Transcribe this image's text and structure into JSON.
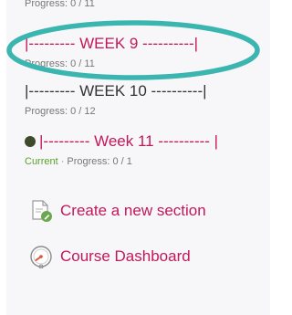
{
  "sections": [
    {
      "title": "",
      "progress": "Progress: 0 / 11"
    },
    {
      "title": "|--------- WEEK 9 ----------|",
      "progress": "Progress: 0 / 11"
    },
    {
      "title": "|--------- WEEK 10 ----------|",
      "progress": "Progress: 0 / 12"
    },
    {
      "title": "|--------- Week 11 ---------- |",
      "status": "Current",
      "separator": "·",
      "progress": "Progress: 0 / 1"
    }
  ],
  "actions": {
    "create_section": "Create a new section",
    "course_dashboard": "Course Dashboard"
  },
  "colors": {
    "link": "#c2185b",
    "highlight_ring": "#3bb5b0",
    "current": "#5aa02c",
    "panel_bg": "#f7f7f9"
  },
  "icons": {
    "create_section": "document-with-pencil-icon",
    "course_dashboard": "speedometer-icon",
    "current_marker": "dot-icon"
  }
}
